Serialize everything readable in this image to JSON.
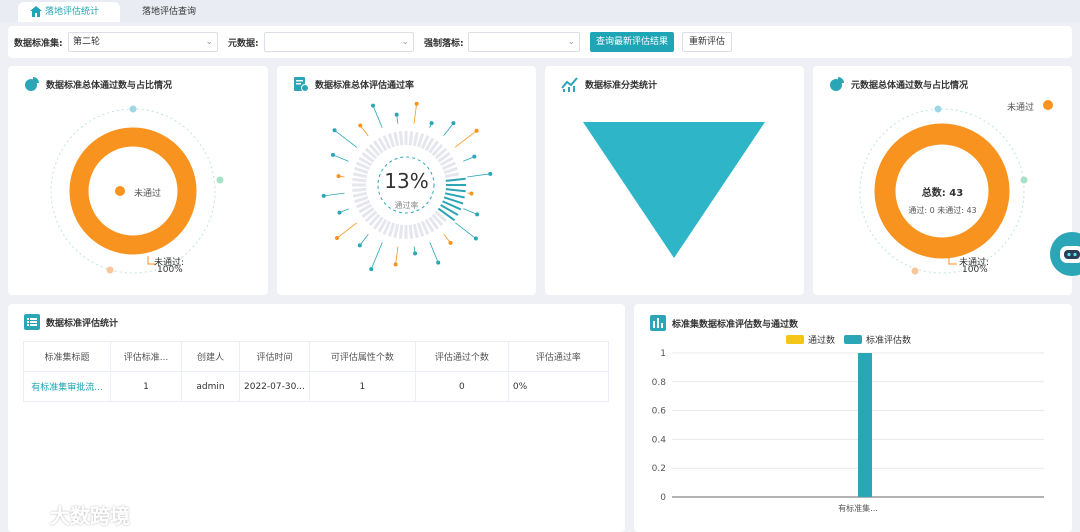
{
  "tabs": [
    {
      "label": "落地评估统计"
    },
    {
      "label": "落地评估查询"
    }
  ],
  "filter": {
    "dataset_label": "数据标准集:",
    "dataset_value": "第二轮",
    "metadata_label": "元数据:",
    "metadata_value": "",
    "mandatory_label": "强制落标:",
    "mandatory_value": "",
    "query_button": "查询最新评估结果",
    "reset_button": "重新评估"
  },
  "card1": {
    "title": "数据标准总体通过数与占比情况",
    "legend": "未通过",
    "label_line1": "未通过:",
    "label_line2": "100%"
  },
  "card2": {
    "title": "数据标准总体评估通过率",
    "percent": "13%",
    "sub": "通过率",
    "rate": 0.13
  },
  "card3": {
    "title": "数据标准分类统计"
  },
  "card4": {
    "title": "元数据总体通过数与占比情况",
    "legend": "未通过",
    "total": "总数: 43",
    "detail": "通过: 0 未通过: 43",
    "label_line1": "未通过:",
    "label_line2": "100%"
  },
  "table_card": {
    "title": "数据标准评估统计",
    "headers": [
      "标准集标题",
      "评估标准...",
      "创建人",
      "评估时间",
      "可评估属性个数",
      "评估通过个数",
      "评估通过率"
    ],
    "rows": [
      [
        "有标准集审批流...",
        "1",
        "admin",
        "2022-07-30...",
        "1",
        "0",
        "0%"
      ]
    ]
  },
  "chart_card": {
    "title": "标准集数据标准评估数与通过数"
  },
  "chart_data": {
    "type": "bar",
    "categories": [
      "有标准集..."
    ],
    "series": [
      {
        "name": "通过数",
        "values": [
          0
        ],
        "color": "#f5c518"
      },
      {
        "name": "标准评估数",
        "values": [
          1
        ],
        "color": "#2aa6b6"
      }
    ],
    "ylim": [
      0,
      1
    ],
    "yticks": [
      "0",
      "0.2",
      "0.4",
      "0.6",
      "0.8",
      "1"
    ],
    "grid": true,
    "legend": "top"
  },
  "watermark": "大数跨境",
  "colors": {
    "accent": "#1fa5b5",
    "orange": "#f7931e",
    "teal": "#2aa6b6"
  }
}
